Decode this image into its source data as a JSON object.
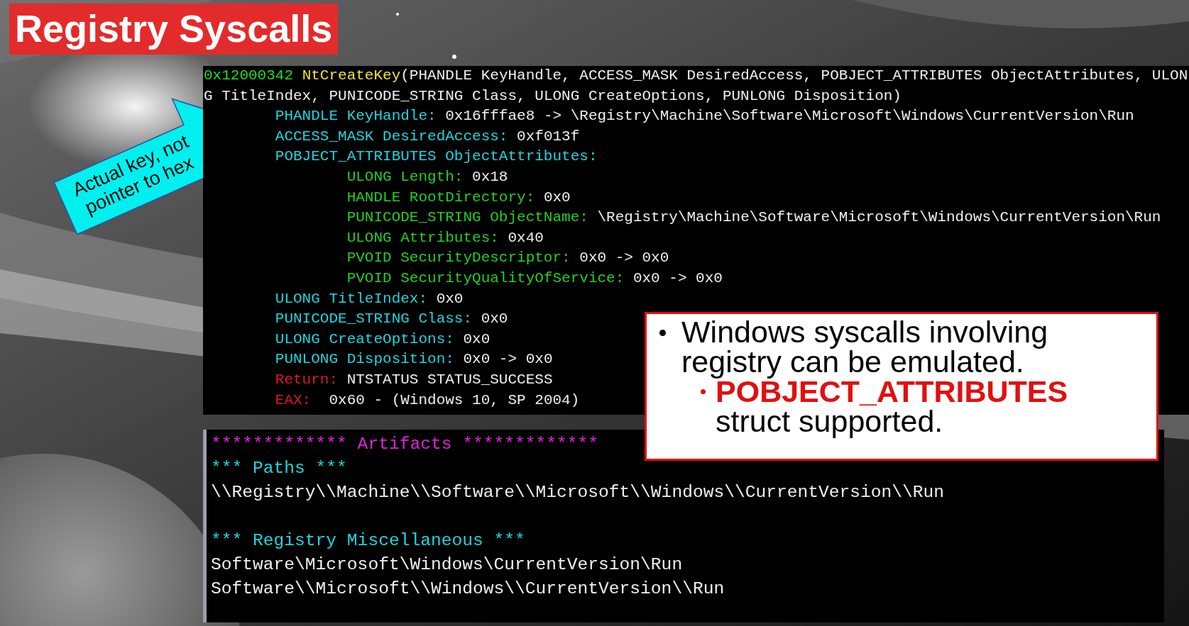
{
  "title": "Registry Syscalls",
  "arrow_callout": {
    "lines": [
      "Actual key, not",
      "pointer to hex"
    ]
  },
  "syscall_console": {
    "call": {
      "address": "0x12000342",
      "name": "NtCreateKey",
      "args": "(PHANDLE KeyHandle, ACCESS_MASK DesiredAccess, POBJECT_ATTRIBUTES ObjectAttributes, ULONG TitleIndex, PUNICODE_STRING Class, ULONG CreateOptions, PUNLONG Disposition)"
    },
    "params": [
      {
        "kind": "param",
        "label": "PHANDLE KeyHandle:",
        "value": "0x16fffae8 -> \\Registry\\Machine\\Software\\Microsoft\\Windows\\CurrentVersion\\Run"
      },
      {
        "kind": "param",
        "label": "ACCESS_MASK DesiredAccess:",
        "value": "0xf013f"
      },
      {
        "kind": "param",
        "label": "POBJECT_ATTRIBUTES ObjectAttributes:",
        "children": [
          {
            "kind": "member",
            "label": "ULONG Length:",
            "value": "0x18"
          },
          {
            "kind": "member",
            "label": "HANDLE RootDirectory:",
            "value": "0x0"
          },
          {
            "kind": "member",
            "label": "PUNICODE_STRING ObjectName:",
            "value": "\\Registry\\Machine\\Software\\Microsoft\\Windows\\CurrentVersion\\Run"
          },
          {
            "kind": "member",
            "label": "ULONG Attributes:",
            "value": "0x40"
          },
          {
            "kind": "member",
            "label": "PVOID SecurityDescriptor:",
            "value": "0x0 -> 0x0"
          },
          {
            "kind": "member",
            "label": "PVOID SecurityQualityOfService:",
            "value": "0x0 -> 0x0"
          }
        ]
      },
      {
        "kind": "param",
        "label": "ULONG TitleIndex:",
        "value": "0x0"
      },
      {
        "kind": "param",
        "label": "PUNICODE_STRING Class:",
        "value": "0x0"
      },
      {
        "kind": "param",
        "label": "ULONG CreateOptions:",
        "value": "0x0"
      },
      {
        "kind": "param",
        "label": "PUNLONG Disposition:",
        "value": "0x0 -> 0x0"
      },
      {
        "kind": "result",
        "label": "Return:",
        "value": "NTSTATUS STATUS_SUCCESS"
      },
      {
        "kind": "result",
        "label": "EAX:",
        "value": " 0x60 - (Windows 10, SP 2004)"
      }
    ]
  },
  "artifacts_console": {
    "banner": "************* Artifacts *************",
    "sections": [
      {
        "heading": "*** Paths ***",
        "items": [
          "\\\\Registry\\\\Machine\\\\Software\\\\Microsoft\\\\Windows\\\\CurrentVersion\\\\Run"
        ]
      },
      {
        "heading": "*** Registry Miscellaneous ***",
        "items": [
          "Software\\Microsoft\\Windows\\CurrentVersion\\Run",
          "Software\\\\Microsoft\\\\Windows\\\\CurrentVersion\\\\Run"
        ]
      }
    ]
  },
  "note": {
    "bullets": [
      {
        "text": "Windows syscalls involving registry can be emulated.",
        "children": [
          {
            "text": "**POBJECT_ATTRIBUTES** struct supported."
          }
        ]
      }
    ]
  }
}
